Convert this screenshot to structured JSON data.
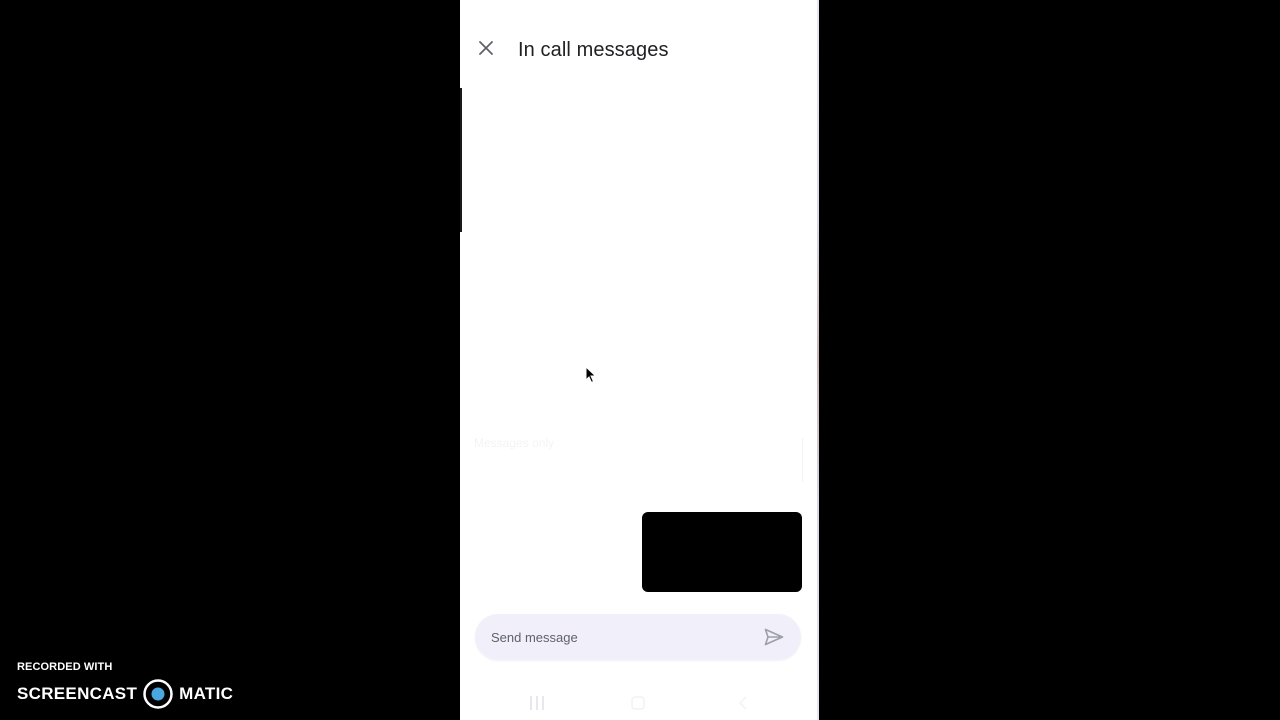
{
  "header": {
    "title": "In call messages",
    "close_icon": "close-icon"
  },
  "messages": {
    "faint_label": "Messages only"
  },
  "self_view": {
    "color": "#000000"
  },
  "composer": {
    "placeholder": "Send message",
    "value": "",
    "send_icon": "send-icon",
    "background": "#f1effa"
  },
  "nav_bar": {
    "items": [
      "recents-icon",
      "home-icon",
      "back-icon"
    ]
  },
  "watermark": {
    "recorded_with": "RECORDED WITH",
    "brand_left": "SCREENCAST",
    "brand_right": "MATIC",
    "logo_color": "#4aa8e0"
  }
}
